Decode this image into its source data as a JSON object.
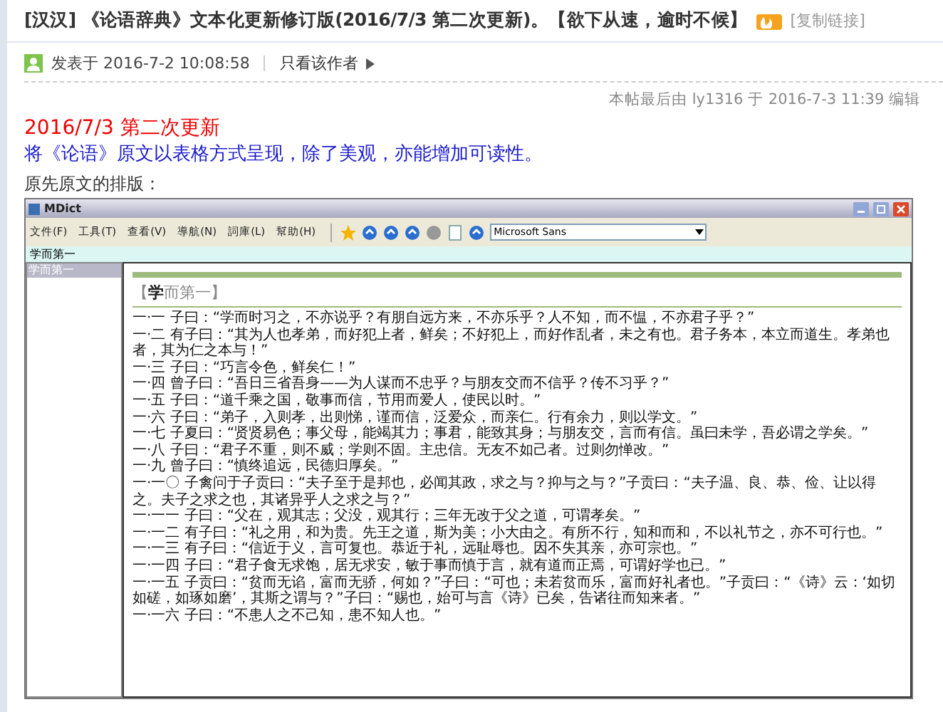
{
  "post": {
    "title": "[汉汉] 《论语辞典》文本化更新修订版(2016/7/3 第二次更新)。【欲下从速，逾时不候】",
    "copy_link": "[复制链接]",
    "posted": "发表于 2016-7-2 10:08:58",
    "author_only": "只看该作者",
    "edit_note": "本帖最后由 ly1316 于 2016-7-3 11:39 编辑",
    "update_heading": "2016/7/3 第二次更新",
    "update_text": "将《论语》原文以表格方式呈现，除了美观，亦能增加可读性。",
    "layout_label": "原先原文的排版："
  },
  "app_window": {
    "title": "MDict",
    "menu": [
      "文件(F)",
      "工具(T)",
      "查看(V)",
      "導航(N)",
      "詞庫(L)",
      "幫助(H)"
    ],
    "font_select": "Microsoft Sans",
    "breadcrumb": "学而第一",
    "index_items": [
      {
        "label": "学而第一",
        "selected": true
      }
    ],
    "heading": "【**学**而第一】",
    "lines": [
      "一·一 子曰：“学而时习之，不亦说乎？有朋自远方来，不亦乐乎？人不知，而不愠，不亦君子乎？”",
      "一·二 有子曰：“其为人也孝弟，而好犯上者，鲜矣；不好犯上，而好作乱者，未之有也。君子务本，本立而道生。孝弟也者，其为仁之本与！”",
      "一·三 子曰：“巧言令色，鲜矣仁！”",
      "一·四 曾子曰：“吾日三省吾身——为人谋而不忠乎？与朋友交而不信乎？传不习乎？”",
      "一·五 子曰：“道千乘之国，敬事而信，节用而爱人，使民以时。”",
      "一·六 子曰：“弟子，入则孝，出则悌，谨而信，泛爱众，而亲仁。行有余力，则以学文。”",
      "一·七 子夏曰：“贤贤易色；事父母，能竭其力；事君，能致其身；与朋友交，言而有信。虽曰未学，吾必谓之学矣。”",
      "一·八 子曰：“君子不重，则不威；学则不固。主忠信。无友不如己者。过则勿惮改。”",
      "一·九 曾子曰：“慎终追远，民德归厚矣。”",
      "一·一〇 子禽问于子贡曰：“夫子至于是邦也，必闻其政，求之与？抑与之与？”子贡曰：“夫子温、良、恭、俭、让以得之。夫子之求之也，其诸异乎人之求之与？”",
      "一·一一 子曰：“父在，观其志；父没，观其行；三年无改于父之道，可谓孝矣。”",
      "一·一二 有子曰：“礼之用，和为贵。先王之道，斯为美；小大由之。有所不行，知和而和，不以礼节之，亦不可行也。”",
      "一·一三 有子曰：“信近于义，言可复也。恭近于礼，远耻辱也。因不失其亲，亦可宗也。”",
      "一·一四 子曰：“君子食无求饱，居无求安，敏于事而慎于言，就有道而正焉，可谓好学也已。”",
      "一·一五 子贡曰：“贫而无谄，富而无骄，何如？”子曰：“可也；未若贫而乐，富而好礼者也。”子贡曰：“《诗》云：‘如切如磋，如琢如磨’，其斯之谓与？”子曰：“赐也，始可与言《诗》已矣，告诸往而知来者。”",
      "一·一六 子曰：“不患人之不己知，患不知人也。”"
    ]
  }
}
